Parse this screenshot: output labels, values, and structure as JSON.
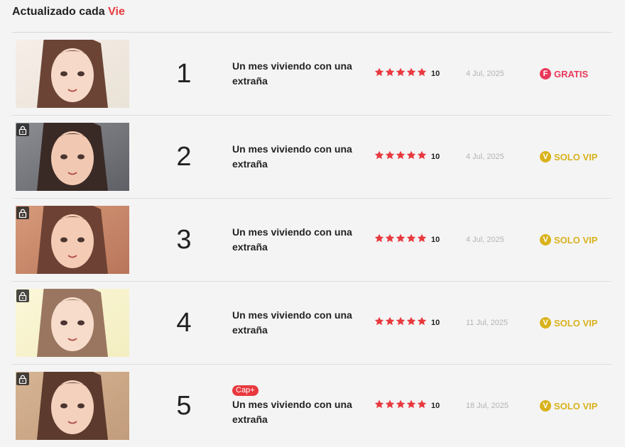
{
  "header": {
    "prefix": "Actualizado cada",
    "day": "Vie"
  },
  "colors": {
    "accent": "#e8393f",
    "vip": "#d9b21c",
    "free": "#e8395a",
    "star": "#e8393f"
  },
  "episodes": [
    {
      "number": "1",
      "cap_badge": "",
      "title": "Un mes viviendo con una extraña",
      "rating": 5,
      "score": "10",
      "date": "4 Jul, 2025",
      "locked": false,
      "status_icon": "F",
      "status_label": "GRATIS",
      "status_type": "free",
      "thumb_icon": "episode-thumbnail"
    },
    {
      "number": "2",
      "cap_badge": "",
      "title": "Un mes viviendo con una extraña",
      "rating": 5,
      "score": "10",
      "date": "4 Jul, 2025",
      "locked": true,
      "status_icon": "V",
      "status_label": "SOLO VIP",
      "status_type": "vip",
      "thumb_icon": "episode-thumbnail"
    },
    {
      "number": "3",
      "cap_badge": "",
      "title": "Un mes viviendo con una extraña",
      "rating": 5,
      "score": "10",
      "date": "4 Jul, 2025",
      "locked": true,
      "status_icon": "V",
      "status_label": "SOLO VIP",
      "status_type": "vip",
      "thumb_icon": "episode-thumbnail"
    },
    {
      "number": "4",
      "cap_badge": "",
      "title": "Un mes viviendo con una extraña",
      "rating": 5,
      "score": "10",
      "date": "11 Jul, 2025",
      "locked": true,
      "status_icon": "V",
      "status_label": "SOLO VIP",
      "status_type": "vip",
      "thumb_icon": "episode-thumbnail"
    },
    {
      "number": "5",
      "cap_badge": "Cap+",
      "title": "Un mes viviendo con una extraña",
      "rating": 5,
      "score": "10",
      "date": "18 Jul, 2025",
      "locked": true,
      "status_icon": "V",
      "status_label": "SOLO VIP",
      "status_type": "vip",
      "thumb_icon": "episode-thumbnail"
    }
  ]
}
